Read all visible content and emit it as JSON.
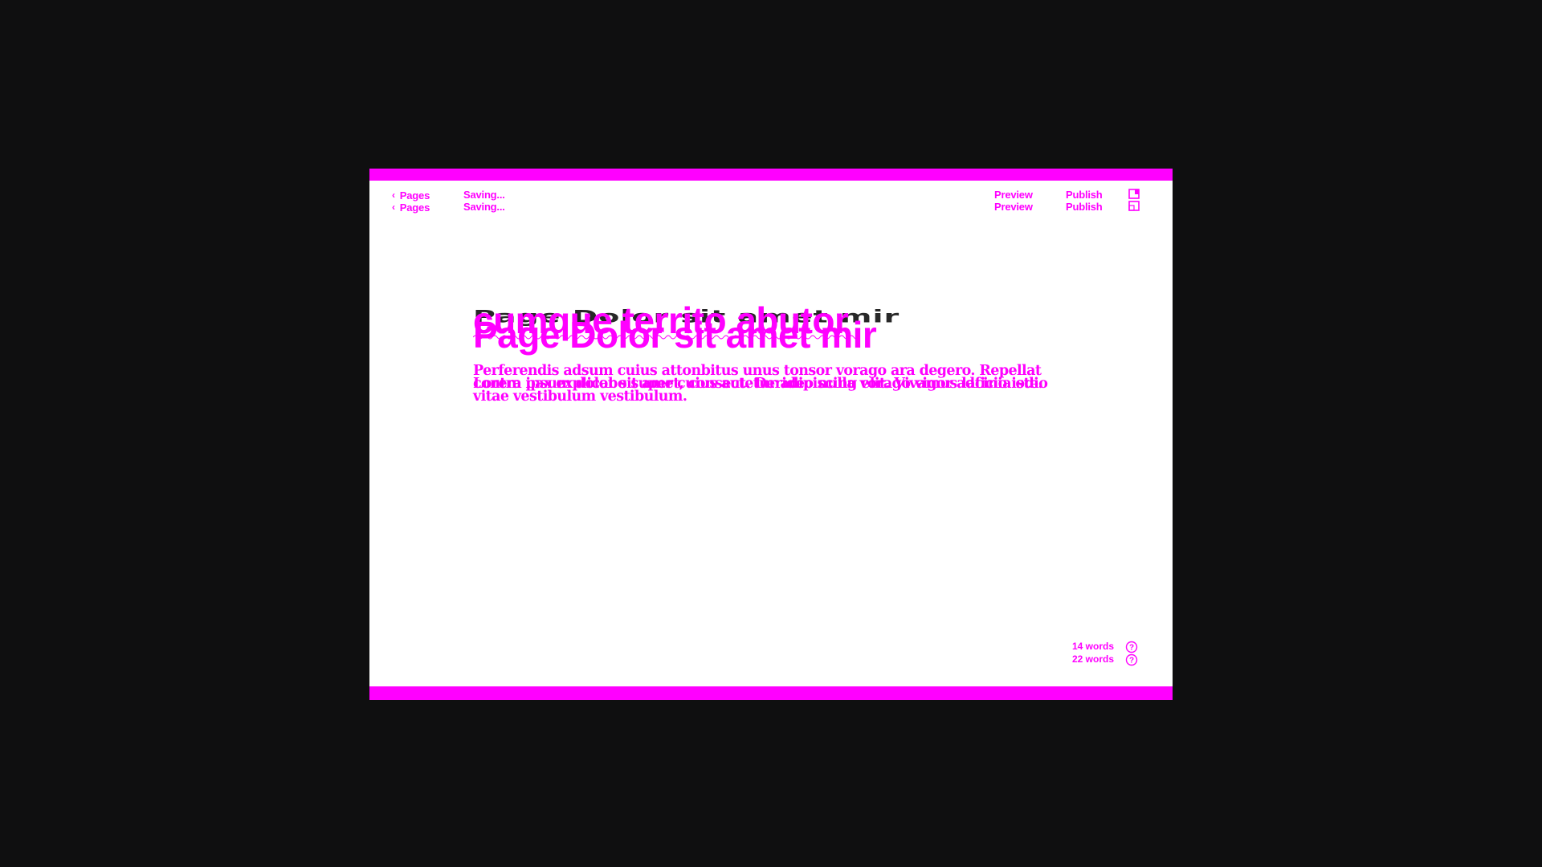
{
  "toolbar": {
    "back_label": "Pages",
    "back_label_2": "Pages",
    "status": "Saving...",
    "status_2": "Saving...",
    "preview": "Preview",
    "preview_2": "Preview",
    "publish": "Publish",
    "publish_2": "Publish",
    "layout_icon": "sidebar-layout-icon",
    "back_icon": "chevron-left-icon"
  },
  "document": {
    "title_ghost": "Page Dolor sit amet mir",
    "title_a": "cumque territo abutor",
    "title_b": "Page Dolor sit amet mir",
    "body_a": "Perferendis adsum cuius attonbitus unus tonsor vorago ara degero. Repellat contra pax explicabo super cuius aut. Derideo nulla vorago vigor adficio iste.",
    "body_b": "Lorem ipsum dolor sit amet, consectetur adipiscing elit. Vivamus lacinia odio vitae vestibulum vestibulum."
  },
  "footer": {
    "word_count_1": "14 words",
    "word_count_2": "22 words",
    "help_icon": "help-circle-icon"
  },
  "colors": {
    "accent": "#ff00ff",
    "backdrop": "#0f0f10",
    "canvas": "#ffffff"
  }
}
